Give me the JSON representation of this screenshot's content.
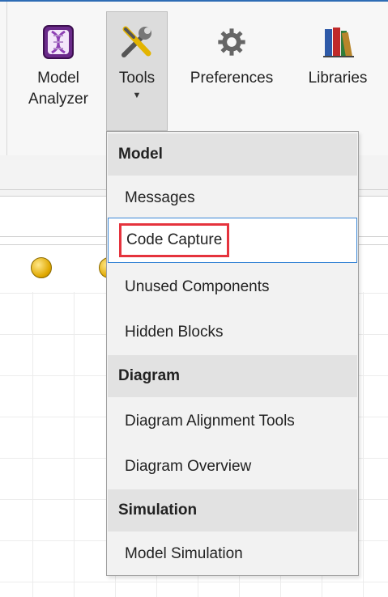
{
  "ribbon": {
    "buttons": [
      {
        "label": "Model\nAnalyzer",
        "icon": "dna-helix-icon"
      },
      {
        "label": "Tools",
        "icon": "wrench-screwdriver-icon"
      },
      {
        "label": "Preferences",
        "icon": "gear-icon"
      },
      {
        "label": "Libraries",
        "icon": "books-icon"
      }
    ]
  },
  "menu": {
    "sections": [
      {
        "header": "Model",
        "items": [
          "Messages",
          "Code Capture",
          "Unused Components",
          "Hidden Blocks"
        ]
      },
      {
        "header": "Diagram",
        "items": [
          "Diagram Alignment Tools",
          "Diagram Overview"
        ]
      },
      {
        "header": "Simulation",
        "items": [
          "Model Simulation"
        ]
      }
    ],
    "highlighted_item": "Code Capture"
  },
  "colors": {
    "accent": "#3b87d6",
    "highlight_box": "#e5333d",
    "top_line": "#2d6cb5"
  }
}
